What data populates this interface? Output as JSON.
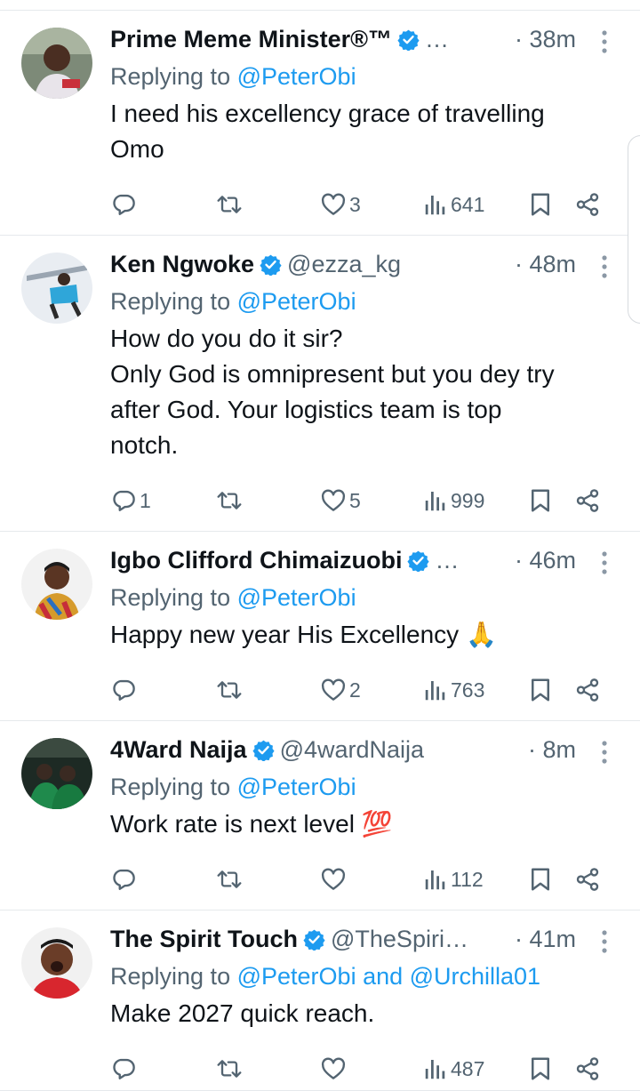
{
  "colors": {
    "accent": "#1d9bf0",
    "secondary_text": "#536471",
    "primary_text": "#0f1419",
    "divider": "#e6e9ec"
  },
  "replies": [
    {
      "display_name": "Prime Meme Minister®™",
      "handle": "…",
      "time": "· 38m",
      "replying_label": "Replying to",
      "replying_to": "@PeterObi",
      "text": "I need his excellency grace of travelling\nOmo",
      "reply_count": "",
      "retweet_count": "",
      "like_count": "3",
      "view_count": "641",
      "icons": [
        "reply-icon",
        "retweet-icon",
        "like-icon",
        "views-icon",
        "bookmark-icon",
        "share-icon",
        "more-icon",
        "verified-badge-icon"
      ]
    },
    {
      "display_name": "Ken Ngwoke",
      "handle": "@ezza_kg",
      "time": "· 48m",
      "replying_label": "Replying to",
      "replying_to": "@PeterObi",
      "text": "How do you do it sir?\nOnly God is omnipresent but you dey try\nafter God. Your logistics team is top\nnotch.",
      "reply_count": "1",
      "retweet_count": "",
      "like_count": "5",
      "view_count": "999"
    },
    {
      "display_name": "Igbo Clifford Chimaizuobi",
      "handle": "…",
      "time": "· 46m",
      "replying_label": "Replying to",
      "replying_to": "@PeterObi",
      "text": "Happy new year His Excellency 🙏",
      "reply_count": "",
      "retweet_count": "",
      "like_count": "2",
      "view_count": "763"
    },
    {
      "display_name": "4Ward Naija",
      "handle": "@4wardNaija",
      "time": "· 8m",
      "replying_label": "Replying to",
      "replying_to": "@PeterObi",
      "text": "Work rate is next level 💯",
      "reply_count": "",
      "retweet_count": "",
      "like_count": "",
      "view_count": "112"
    },
    {
      "display_name": "The Spirit Touch",
      "handle": "@TheSpiri…",
      "time": "· 41m",
      "replying_label": "Replying to",
      "replying_to": "@PeterObi and @Urchilla01",
      "text": "Make 2027 quick reach.",
      "reply_count": "",
      "retweet_count": "",
      "like_count": "",
      "view_count": "487"
    }
  ]
}
